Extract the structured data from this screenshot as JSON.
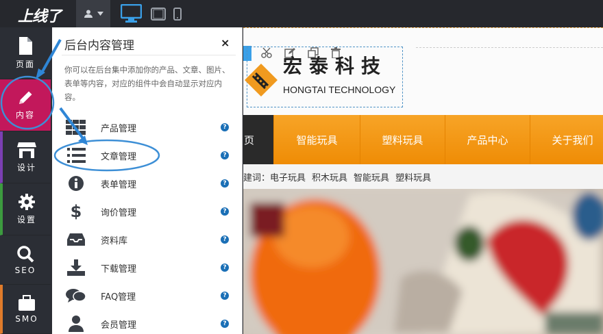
{
  "topbar": {
    "logo_text": "上线了",
    "user_icon": "user-icon",
    "devices": [
      "desktop-icon",
      "tablet-icon",
      "mobile-icon"
    ]
  },
  "sidebar": {
    "items": [
      {
        "label": "页面",
        "icon": "page-icon"
      },
      {
        "label": "内容",
        "icon": "pencil-icon"
      },
      {
        "label": "设计",
        "icon": "store-icon"
      },
      {
        "label": "设置",
        "icon": "gear-icon"
      },
      {
        "label": "SEO",
        "icon": "search-icon"
      },
      {
        "label": "SMO",
        "icon": "briefcase-icon"
      }
    ],
    "colors": {
      "active": "#c2185b",
      "content_accent": "#e84a7a"
    }
  },
  "panel": {
    "title": "后台内容管理",
    "close": "×",
    "description": "你可以在后台集中添加你的产品、文章、图片、表单等内容，对应的组件中会自动显示对应内容。",
    "items": [
      {
        "label": "产品管理",
        "icon": "grid-icon"
      },
      {
        "label": "文章管理",
        "icon": "list-icon"
      },
      {
        "label": "表单管理",
        "icon": "info-icon"
      },
      {
        "label": "询价管理",
        "icon": "dollar-icon"
      },
      {
        "label": "资料库",
        "icon": "inbox-icon"
      },
      {
        "label": "下载管理",
        "icon": "download-icon"
      },
      {
        "label": "FAQ管理",
        "icon": "chat-icon"
      },
      {
        "label": "会员管理",
        "icon": "member-icon"
      }
    ],
    "help": "?"
  },
  "site": {
    "brand_cn": "宏泰科技",
    "brand_en": "HONGTAI TECHNOLOGY",
    "nav": [
      "页",
      "智能玩具",
      "塑料玩具",
      "产品中心",
      "关于我们"
    ],
    "keywords_label": "建词：",
    "keywords": [
      "电子玩具",
      "积木玩具",
      "智能玩具",
      "塑料玩具"
    ],
    "colors": {
      "nav": "#f39a14",
      "accent": "#1a6fb6"
    }
  }
}
